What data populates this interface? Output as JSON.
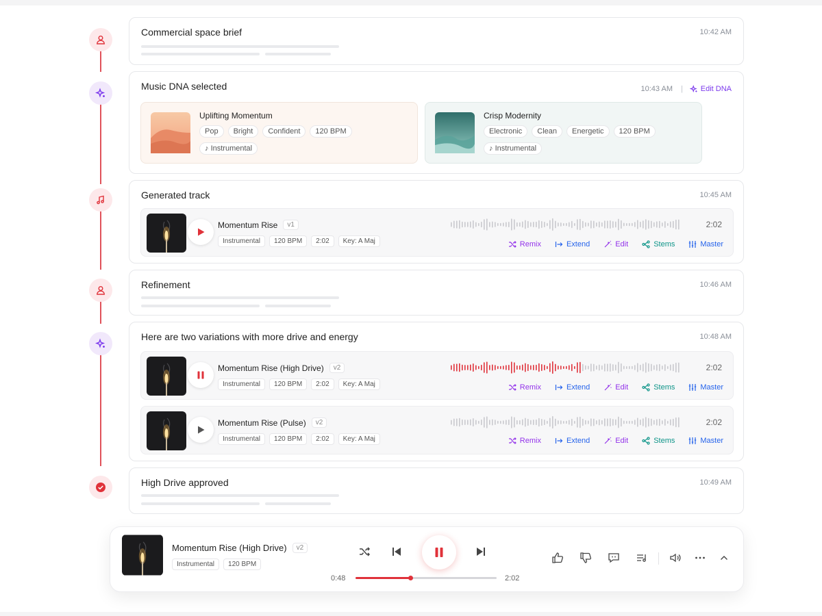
{
  "colors": {
    "accent": "#e0323a",
    "ai": "#7c3aed",
    "stems": "#0d9488",
    "link": "#2563eb"
  },
  "timeline": {
    "brief": {
      "icon": "user-icon",
      "title": "Commercial space brief",
      "time": "10:42 AM"
    },
    "dna": {
      "icon": "sparkle-icon",
      "title": "Music DNA selected",
      "time": "10:43 AM",
      "edit_label": "Edit DNA",
      "profiles": [
        {
          "name": "Uplifting Momentum",
          "tags": [
            "Pop",
            "Bright",
            "Confident",
            "120 BPM"
          ],
          "type": "Instrumental"
        },
        {
          "name": "Crisp Modernity",
          "tags": [
            "Electronic",
            "Clean",
            "Energetic",
            "120 BPM"
          ],
          "type": "Instrumental"
        }
      ]
    },
    "generated": {
      "icon": "music-note-icon",
      "title": "Generated track",
      "time": "10:45 AM",
      "track": {
        "name": "Momentum Rise",
        "version": "v1",
        "tags": [
          "Instrumental",
          "120 BPM",
          "2:02",
          "Key: A Maj"
        ],
        "duration": "2:02",
        "progress": 0
      }
    },
    "refinement": {
      "icon": "user-icon",
      "title": "Refinement",
      "time": "10:46 AM"
    },
    "variations": {
      "icon": "sparkle-icon",
      "title": "Here are two variations with more drive and energy",
      "time": "10:48 AM",
      "tracks": [
        {
          "name": "Momentum Rise (High Drive)",
          "version": "v2",
          "tags": [
            "Instrumental",
            "120 BPM",
            "2:02",
            "Key: A Maj"
          ],
          "duration": "2:02",
          "playing": true,
          "progress": 0.57
        },
        {
          "name": "Momentum Rise (Pulse)",
          "version": "v2",
          "tags": [
            "Instrumental",
            "120 BPM",
            "2:02",
            "Key: A Maj"
          ],
          "duration": "2:02",
          "playing": false,
          "progress": 0
        }
      ]
    },
    "approved": {
      "icon": "check-circle-icon",
      "title": "High Drive approved",
      "time": "10:49 AM"
    }
  },
  "actions": {
    "remix": "Remix",
    "extend": "Extend",
    "edit": "Edit",
    "stems": "Stems",
    "master": "Master"
  },
  "player": {
    "title": "Momentum Rise (High Drive)",
    "version": "v2",
    "tags": [
      "Instrumental",
      "120 BPM"
    ],
    "current_time": "0:48",
    "total_time": "2:02",
    "progress": 0.39
  }
}
